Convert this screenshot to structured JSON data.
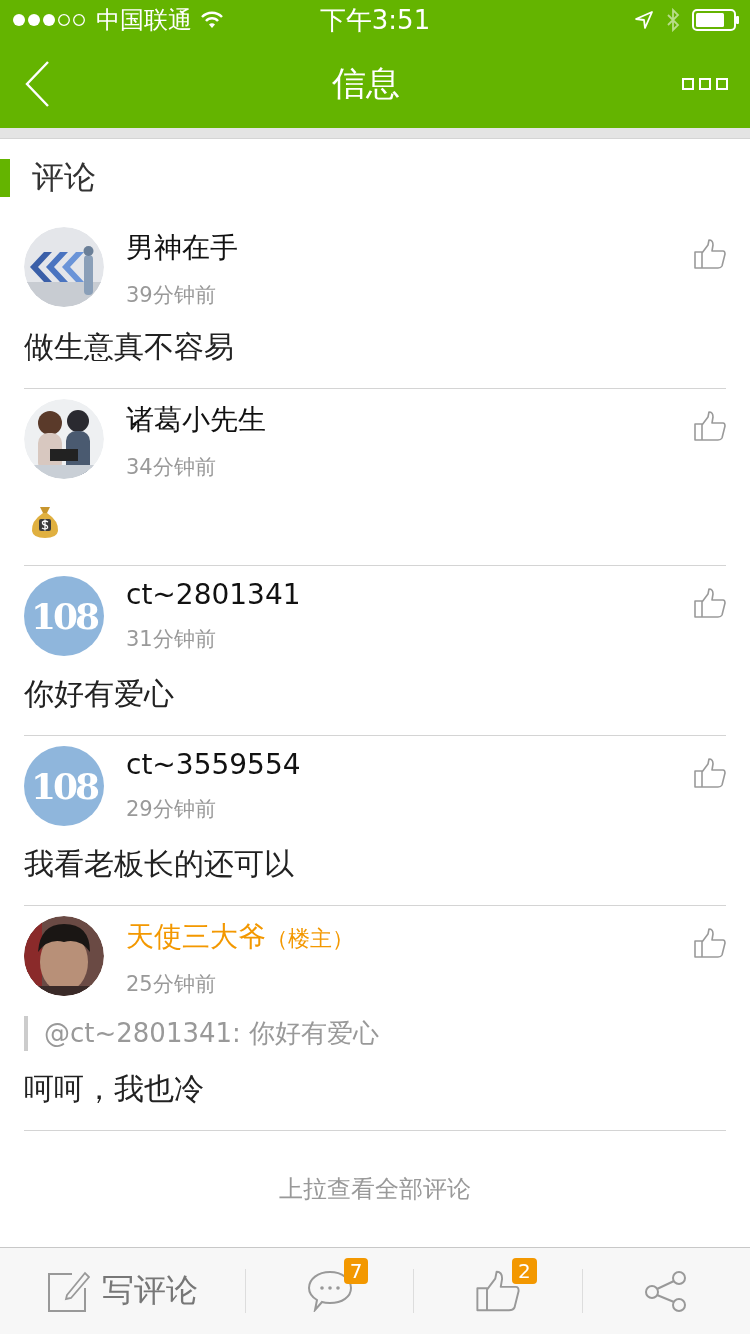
{
  "status_bar": {
    "carrier": "中国联通",
    "time": "下午3:51"
  },
  "nav": {
    "title": "信息"
  },
  "section": {
    "title": "评论"
  },
  "comments": [
    {
      "name": "男神在手",
      "time": "39分钟前",
      "avatar": {
        "kind": "photo-arrows"
      },
      "body": "做生意真不容易",
      "owner": false
    },
    {
      "name": "诸葛小先生",
      "time": "34分钟前",
      "avatar": {
        "kind": "photo-couple"
      },
      "attachment": {
        "kind": "money-bag"
      },
      "owner": false
    },
    {
      "name": "ct~2801341",
      "time": "31分钟前",
      "avatar": {
        "kind": "logo",
        "text": "108"
      },
      "body": "你好有爱心",
      "owner": false
    },
    {
      "name": "ct~3559554",
      "time": "29分钟前",
      "avatar": {
        "kind": "logo",
        "text": "108"
      },
      "body": "我看老板长的还可以",
      "owner": false
    },
    {
      "name": "天使三大爷",
      "badge": "（楼主）",
      "time": "25分钟前",
      "avatar": {
        "kind": "photo-person"
      },
      "quote": "@ct~2801341: 你好有爱心",
      "body": "呵呵，我也冷",
      "owner": true
    }
  ],
  "load_more": "上拉查看全部评论",
  "bottom_bar": {
    "write": "写评论",
    "comment_count": "7",
    "like_count": "2"
  }
}
